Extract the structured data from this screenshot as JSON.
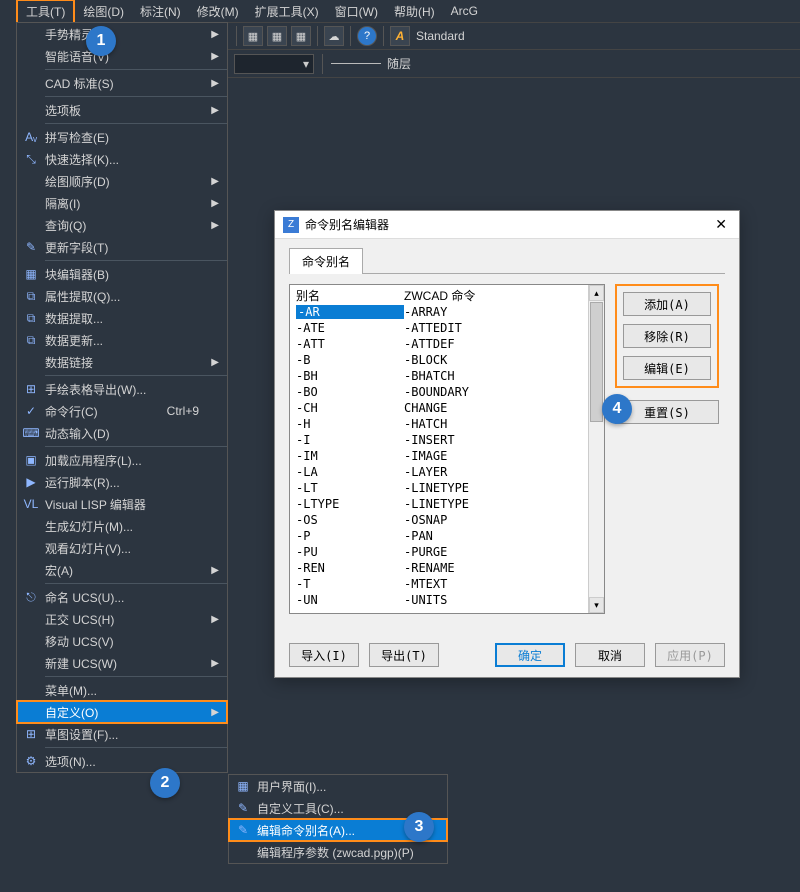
{
  "menubar": {
    "active": "工具(T)",
    "items_partial": [
      "绘图(D)",
      "标注(N)",
      "修改(M)",
      "扩展工具(X)",
      "窗口(W)",
      "帮助(H)",
      "ArcG"
    ]
  },
  "toolbar": {
    "style_text": "Standard"
  },
  "propbar": {
    "arrow": "▾",
    "layer": "随层"
  },
  "dropdown": {
    "items": [
      {
        "label": "手势精灵",
        "arrow": true
      },
      {
        "label": "智能语音(V)",
        "arrow": true
      },
      {
        "sep": true
      },
      {
        "label": "CAD 标准(S)",
        "arrow": true
      },
      {
        "sep": true
      },
      {
        "label": "选项板",
        "arrow": true
      },
      {
        "sep": true
      },
      {
        "icon": "Aᵥ",
        "label": "拼写检查(E)"
      },
      {
        "icon": "⤡",
        "label": "快速选择(K)..."
      },
      {
        "label": "绘图顺序(D)",
        "arrow": true
      },
      {
        "label": "隔离(I)",
        "arrow": true
      },
      {
        "label": "查询(Q)",
        "arrow": true
      },
      {
        "icon": "✎",
        "label": "更新字段(T)"
      },
      {
        "sep": true
      },
      {
        "icon": "▦",
        "label": "块编辑器(B)"
      },
      {
        "icon": "⧉",
        "label": "属性提取(Q)..."
      },
      {
        "icon": "⧉",
        "label": "数据提取..."
      },
      {
        "icon": "⧉",
        "label": "数据更新..."
      },
      {
        "label": "数据链接",
        "arrow": true
      },
      {
        "sep": true
      },
      {
        "icon": "⊞",
        "label": "手绘表格导出(W)..."
      },
      {
        "icon": "✓",
        "label": "命令行(C)",
        "shortcut": "Ctrl+9"
      },
      {
        "icon": "⌨",
        "label": "动态输入(D)"
      },
      {
        "sep": true
      },
      {
        "icon": "▣",
        "label": "加载应用程序(L)..."
      },
      {
        "icon": "▶",
        "label": "运行脚本(R)..."
      },
      {
        "icon": "VL",
        "label": "Visual LISP 编辑器"
      },
      {
        "label": "生成幻灯片(M)..."
      },
      {
        "label": "观看幻灯片(V)..."
      },
      {
        "label": "宏(A)",
        "arrow": true
      },
      {
        "sep": true
      },
      {
        "icon": "⎋",
        "label": "命名 UCS(U)..."
      },
      {
        "label": "正交 UCS(H)",
        "arrow": true
      },
      {
        "label": "移动 UCS(V)"
      },
      {
        "label": "新建 UCS(W)",
        "arrow": true
      },
      {
        "sep": true
      },
      {
        "label": "菜单(M)..."
      },
      {
        "label": "自定义(O)",
        "arrow": true,
        "hover": true,
        "boxed": true
      },
      {
        "icon": "⊞",
        "label": "草图设置(F)..."
      },
      {
        "sep": true
      },
      {
        "icon": "⚙",
        "label": "选项(N)..."
      }
    ]
  },
  "submenu": {
    "items": [
      {
        "icon": "▦",
        "label": "用户界面(I)..."
      },
      {
        "icon": "✎",
        "label": "自定义工具(C)..."
      },
      {
        "icon": "✎",
        "label": "编辑命令别名(A)...",
        "hover": true,
        "boxed": true
      },
      {
        "label": "编辑程序参数 (zwcad.pgp)(P)"
      }
    ]
  },
  "dialog": {
    "title": "命令别名编辑器",
    "tab": "命令别名",
    "header_alias": "别名",
    "header_cmd": "ZWCAD 命令",
    "rows": [
      {
        "a": "-AR",
        "c": "-ARRAY",
        "sel": true
      },
      {
        "a": "-ATE",
        "c": "-ATTEDIT"
      },
      {
        "a": "-ATT",
        "c": "-ATTDEF"
      },
      {
        "a": "-B",
        "c": "-BLOCK"
      },
      {
        "a": "-BH",
        "c": "-BHATCH"
      },
      {
        "a": "-BO",
        "c": "-BOUNDARY"
      },
      {
        "a": "-CH",
        "c": "CHANGE"
      },
      {
        "a": "-H",
        "c": "-HATCH"
      },
      {
        "a": "-I",
        "c": "-INSERT"
      },
      {
        "a": "-IM",
        "c": "-IMAGE"
      },
      {
        "a": "-LA",
        "c": "-LAYER"
      },
      {
        "a": "-LT",
        "c": "-LINETYPE"
      },
      {
        "a": "-LTYPE",
        "c": "-LINETYPE"
      },
      {
        "a": "-OS",
        "c": "-OSNAP"
      },
      {
        "a": "-P",
        "c": "-PAN"
      },
      {
        "a": "-PU",
        "c": "-PURGE"
      },
      {
        "a": "-REN",
        "c": "-RENAME"
      },
      {
        "a": "-T",
        "c": "-MTEXT"
      },
      {
        "a": "-UN",
        "c": "-UNITS"
      }
    ],
    "buttons": {
      "add": "添加(A)",
      "remove": "移除(R)",
      "edit": "编辑(E)",
      "reset": "重置(S)",
      "import": "导入(I)",
      "export": "导出(T)",
      "ok": "确定",
      "cancel": "取消",
      "apply": "应用(P)"
    }
  },
  "steps": {
    "s1": "1",
    "s2": "2",
    "s3": "3",
    "s4": "4"
  }
}
